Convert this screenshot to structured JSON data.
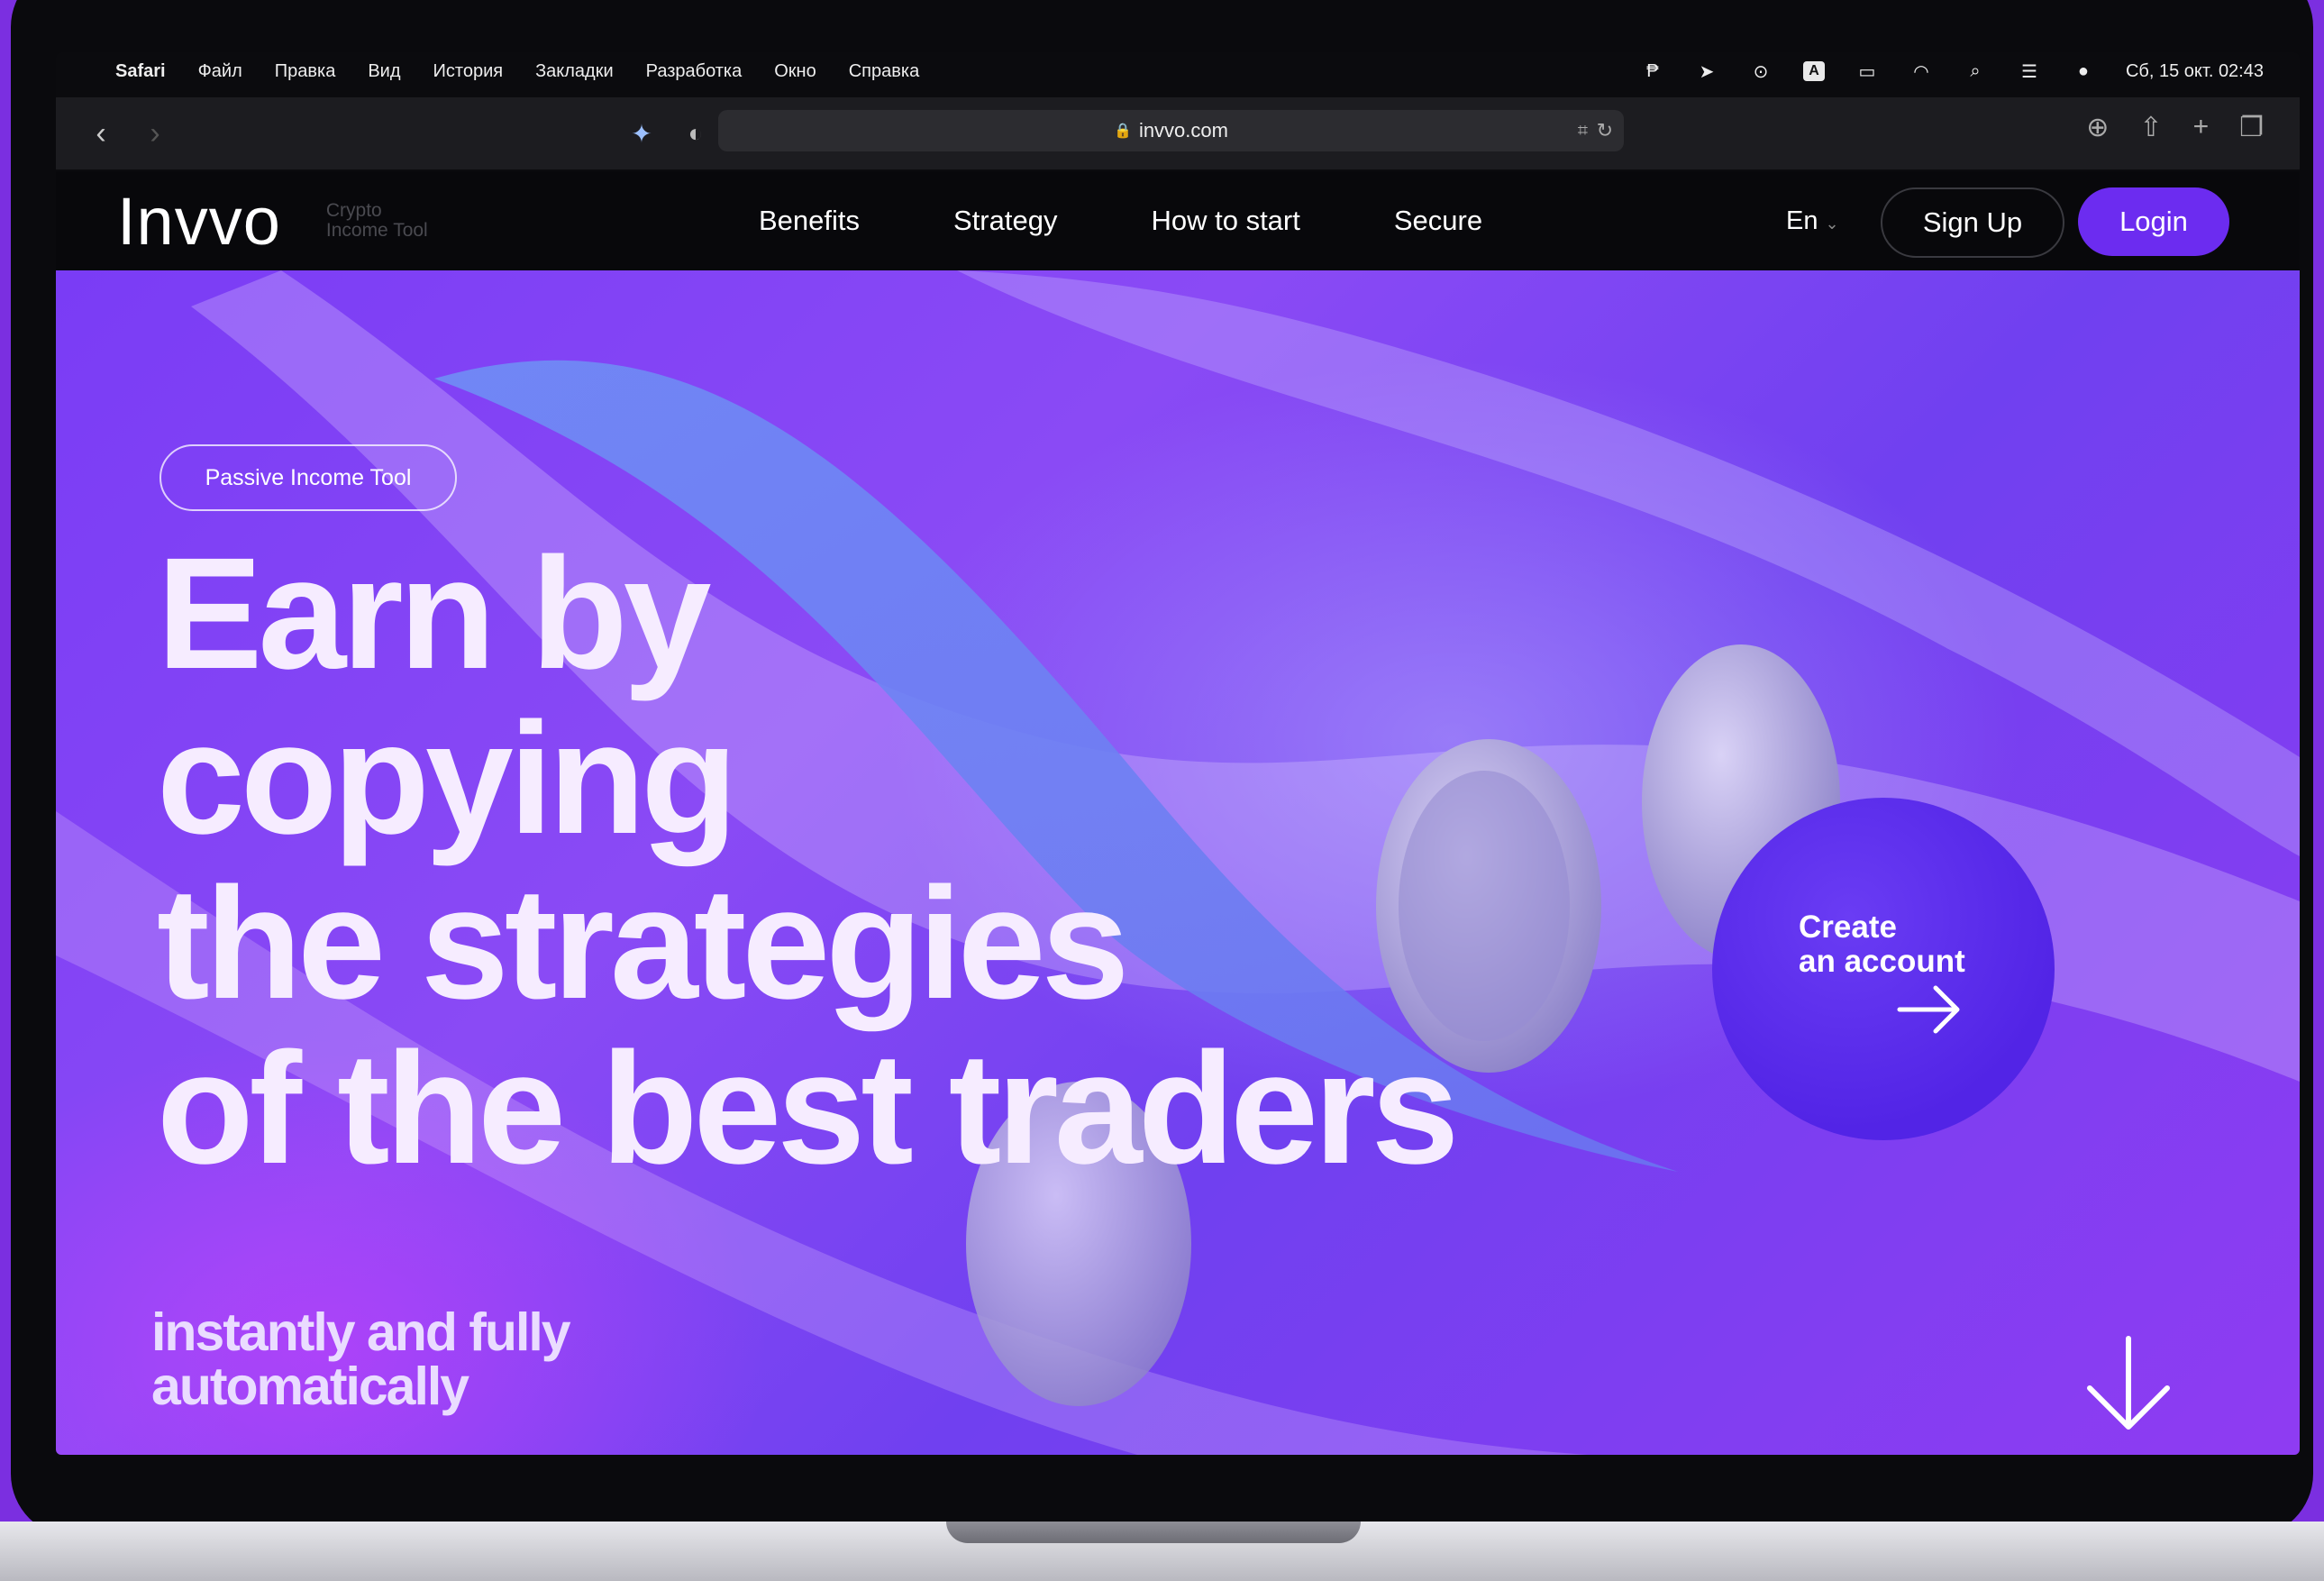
{
  "menubar": {
    "app_name": "Safari",
    "items": [
      "Файл",
      "Правка",
      "Вид",
      "История",
      "Закладки",
      "Разработка",
      "Окно",
      "Справка"
    ],
    "datetime": "Сб, 15 окт.  02:43"
  },
  "browser": {
    "url": "invvo.com"
  },
  "header": {
    "logo": "Invvo",
    "logo_sub_line1": "Crypto",
    "logo_sub_line2": "Income Tool",
    "nav": [
      "Benefits",
      "Strategy",
      "How to start",
      "Secure"
    ],
    "language": "En",
    "signup_label": "Sign Up",
    "login_label": "Login"
  },
  "hero": {
    "badge": "Passive Income Tool",
    "headline_lines": [
      "Earn by",
      "copying",
      "the strategies",
      "of the best traders"
    ],
    "subline_lines": [
      "instantly and fully",
      "automatically"
    ],
    "cta_line1": "Create",
    "cta_line2": "an account"
  },
  "colors": {
    "accent": "#6c2cf0",
    "hero_background": "#7a3cf5",
    "header_background": "#08080b"
  },
  "icons": [
    "apple-icon",
    "back-icon",
    "forward-icon",
    "shield-icon",
    "reader-icon",
    "lock-icon",
    "reload-icon",
    "download-icon",
    "share-icon",
    "new-tab-icon",
    "tabs-icon",
    "arrow-right-icon",
    "arrow-down-icon"
  ]
}
